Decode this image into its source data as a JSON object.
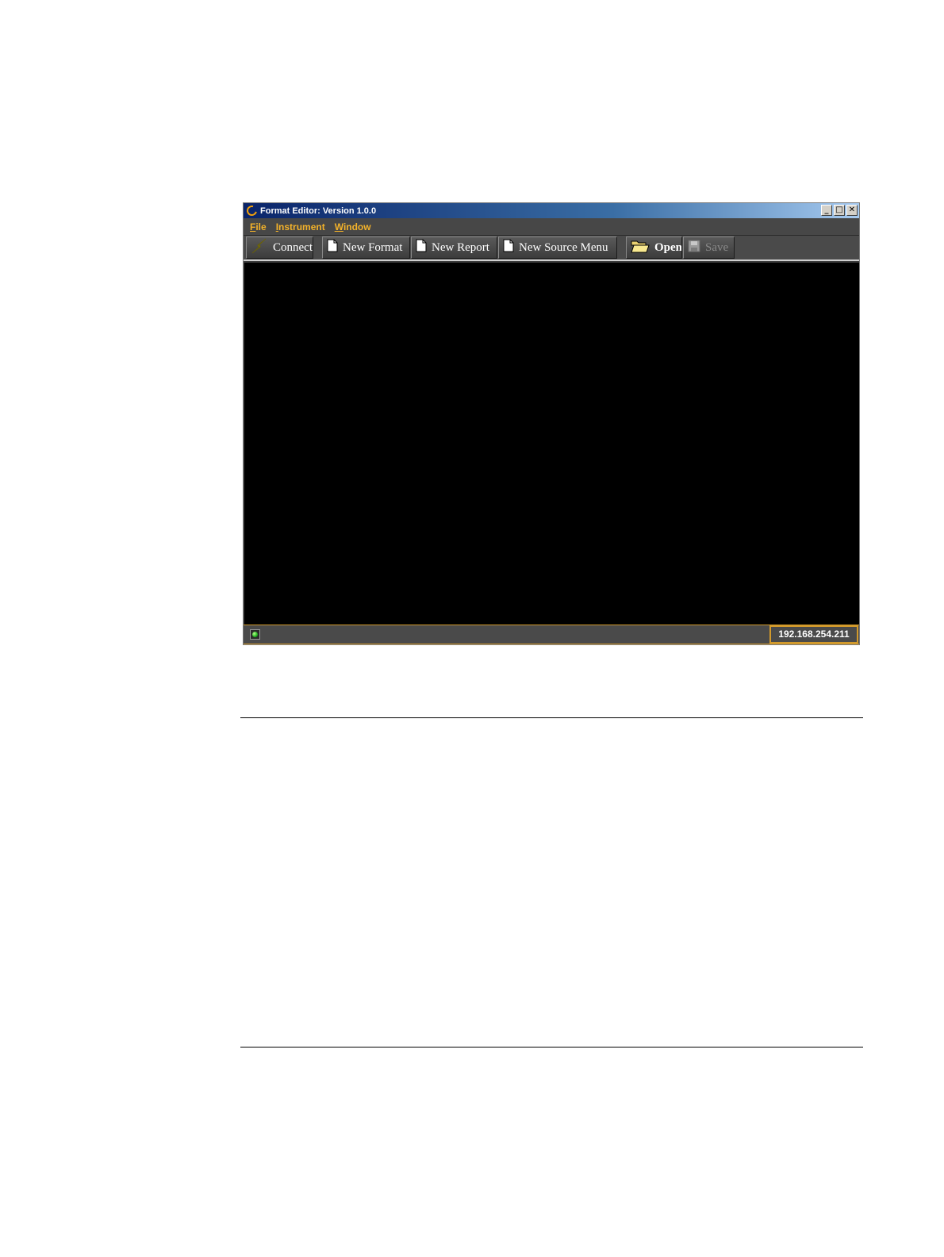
{
  "window": {
    "title": "Format Editor: Version 1.0.0",
    "controls": {
      "minimize": "_",
      "maximize": "□",
      "close": "✕"
    }
  },
  "menu": {
    "file": {
      "mnemonic": "F",
      "rest": "ile"
    },
    "instrument": {
      "mnemonic": "I",
      "rest": "nstrument"
    },
    "window": {
      "mnemonic": "W",
      "rest": "indow"
    }
  },
  "toolbar": {
    "connect": "Connect",
    "new_format": "New Format",
    "new_report": "New Report",
    "new_source_menu": "New Source Menu",
    "open": "Open",
    "save": "Save"
  },
  "status": {
    "ip_address": "192.168.254.211",
    "connection_state_color": "#1fb31f"
  },
  "colors": {
    "menu_accent": "#f3b22a",
    "status_border": "#d29a2c",
    "titlebar_start": "#0a246a"
  }
}
